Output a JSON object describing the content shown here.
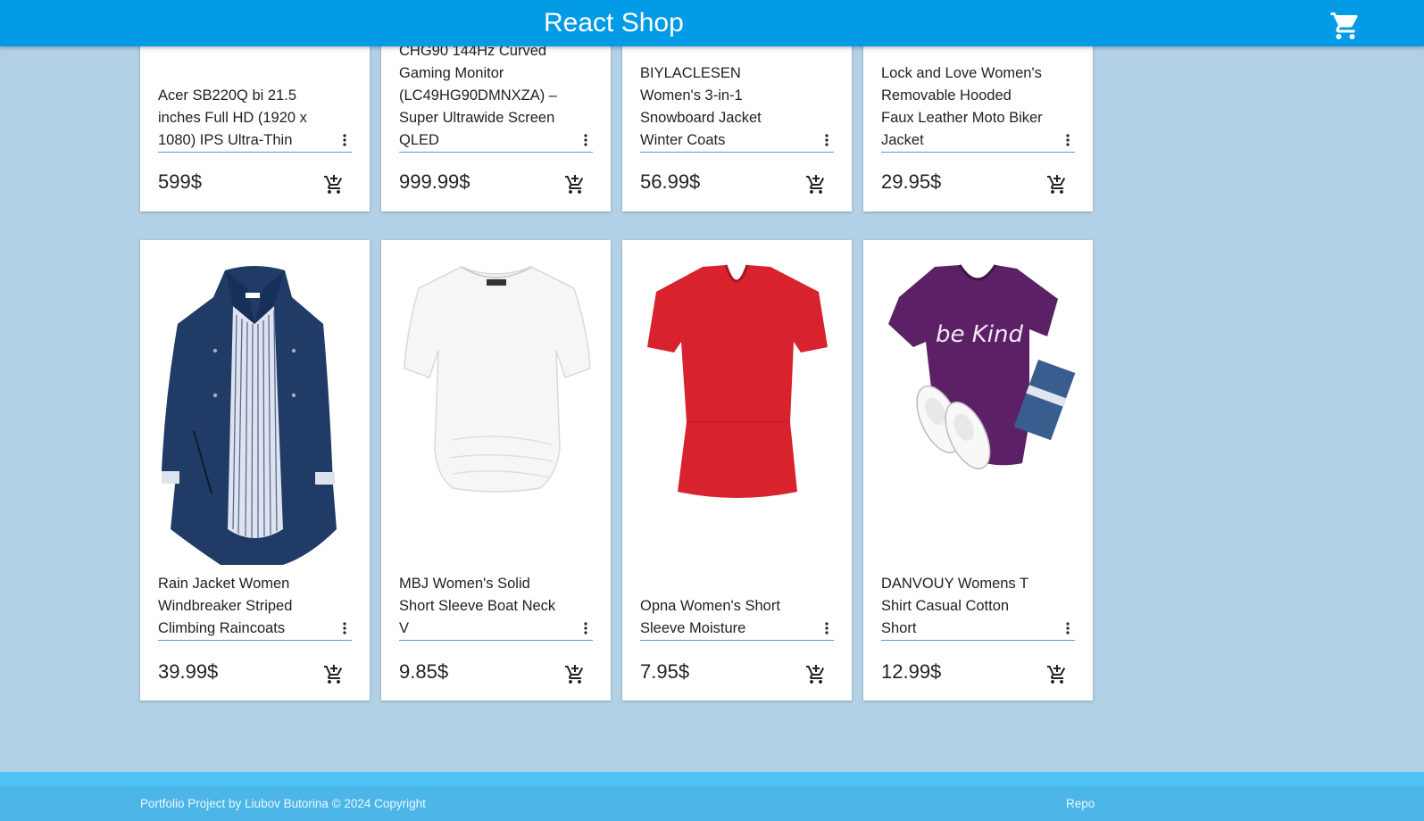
{
  "app": {
    "title": "React Shop",
    "cart_icon": "shopping-cart-icon"
  },
  "products_top": [
    {
      "name": "Acer SB220Q bi 21.5 inches Full HD (1920 x 1080) IPS Ultra-Thin",
      "price": "599$"
    },
    {
      "name": "CHG90 144Hz Curved Gaming Monitor (LC49HG90DMNXZA) – Super Ultrawide Screen QLED",
      "price": "999.99$"
    },
    {
      "name": "BIYLACLESEN Women's 3-in-1 Snowboard Jacket Winter Coats",
      "price": "56.99$"
    },
    {
      "name": "Lock and Love Women's Removable Hooded Faux Leather Moto Biker Jacket",
      "price": "29.95$"
    }
  ],
  "products_bottom": [
    {
      "name": "Rain Jacket Women Windbreaker Striped Climbing Raincoats",
      "price": "39.99$"
    },
    {
      "name": "MBJ Women's Solid Short Sleeve Boat Neck V",
      "price": "9.85$"
    },
    {
      "name": "Opna Women's Short Sleeve Moisture",
      "price": "7.95$"
    },
    {
      "name": "DANVOUY Womens T Shirt Casual Cotton Short",
      "price": "12.99$"
    }
  ],
  "tshirt_print": "be Kind",
  "footer": {
    "copyright": "Portfolio Project by Liubov Butorina © 2024 Copyright",
    "repo_label": "Repo"
  },
  "colors": {
    "appbar": "#039be5",
    "background": "#b3d1e6",
    "footer": "#4fc3f7"
  }
}
